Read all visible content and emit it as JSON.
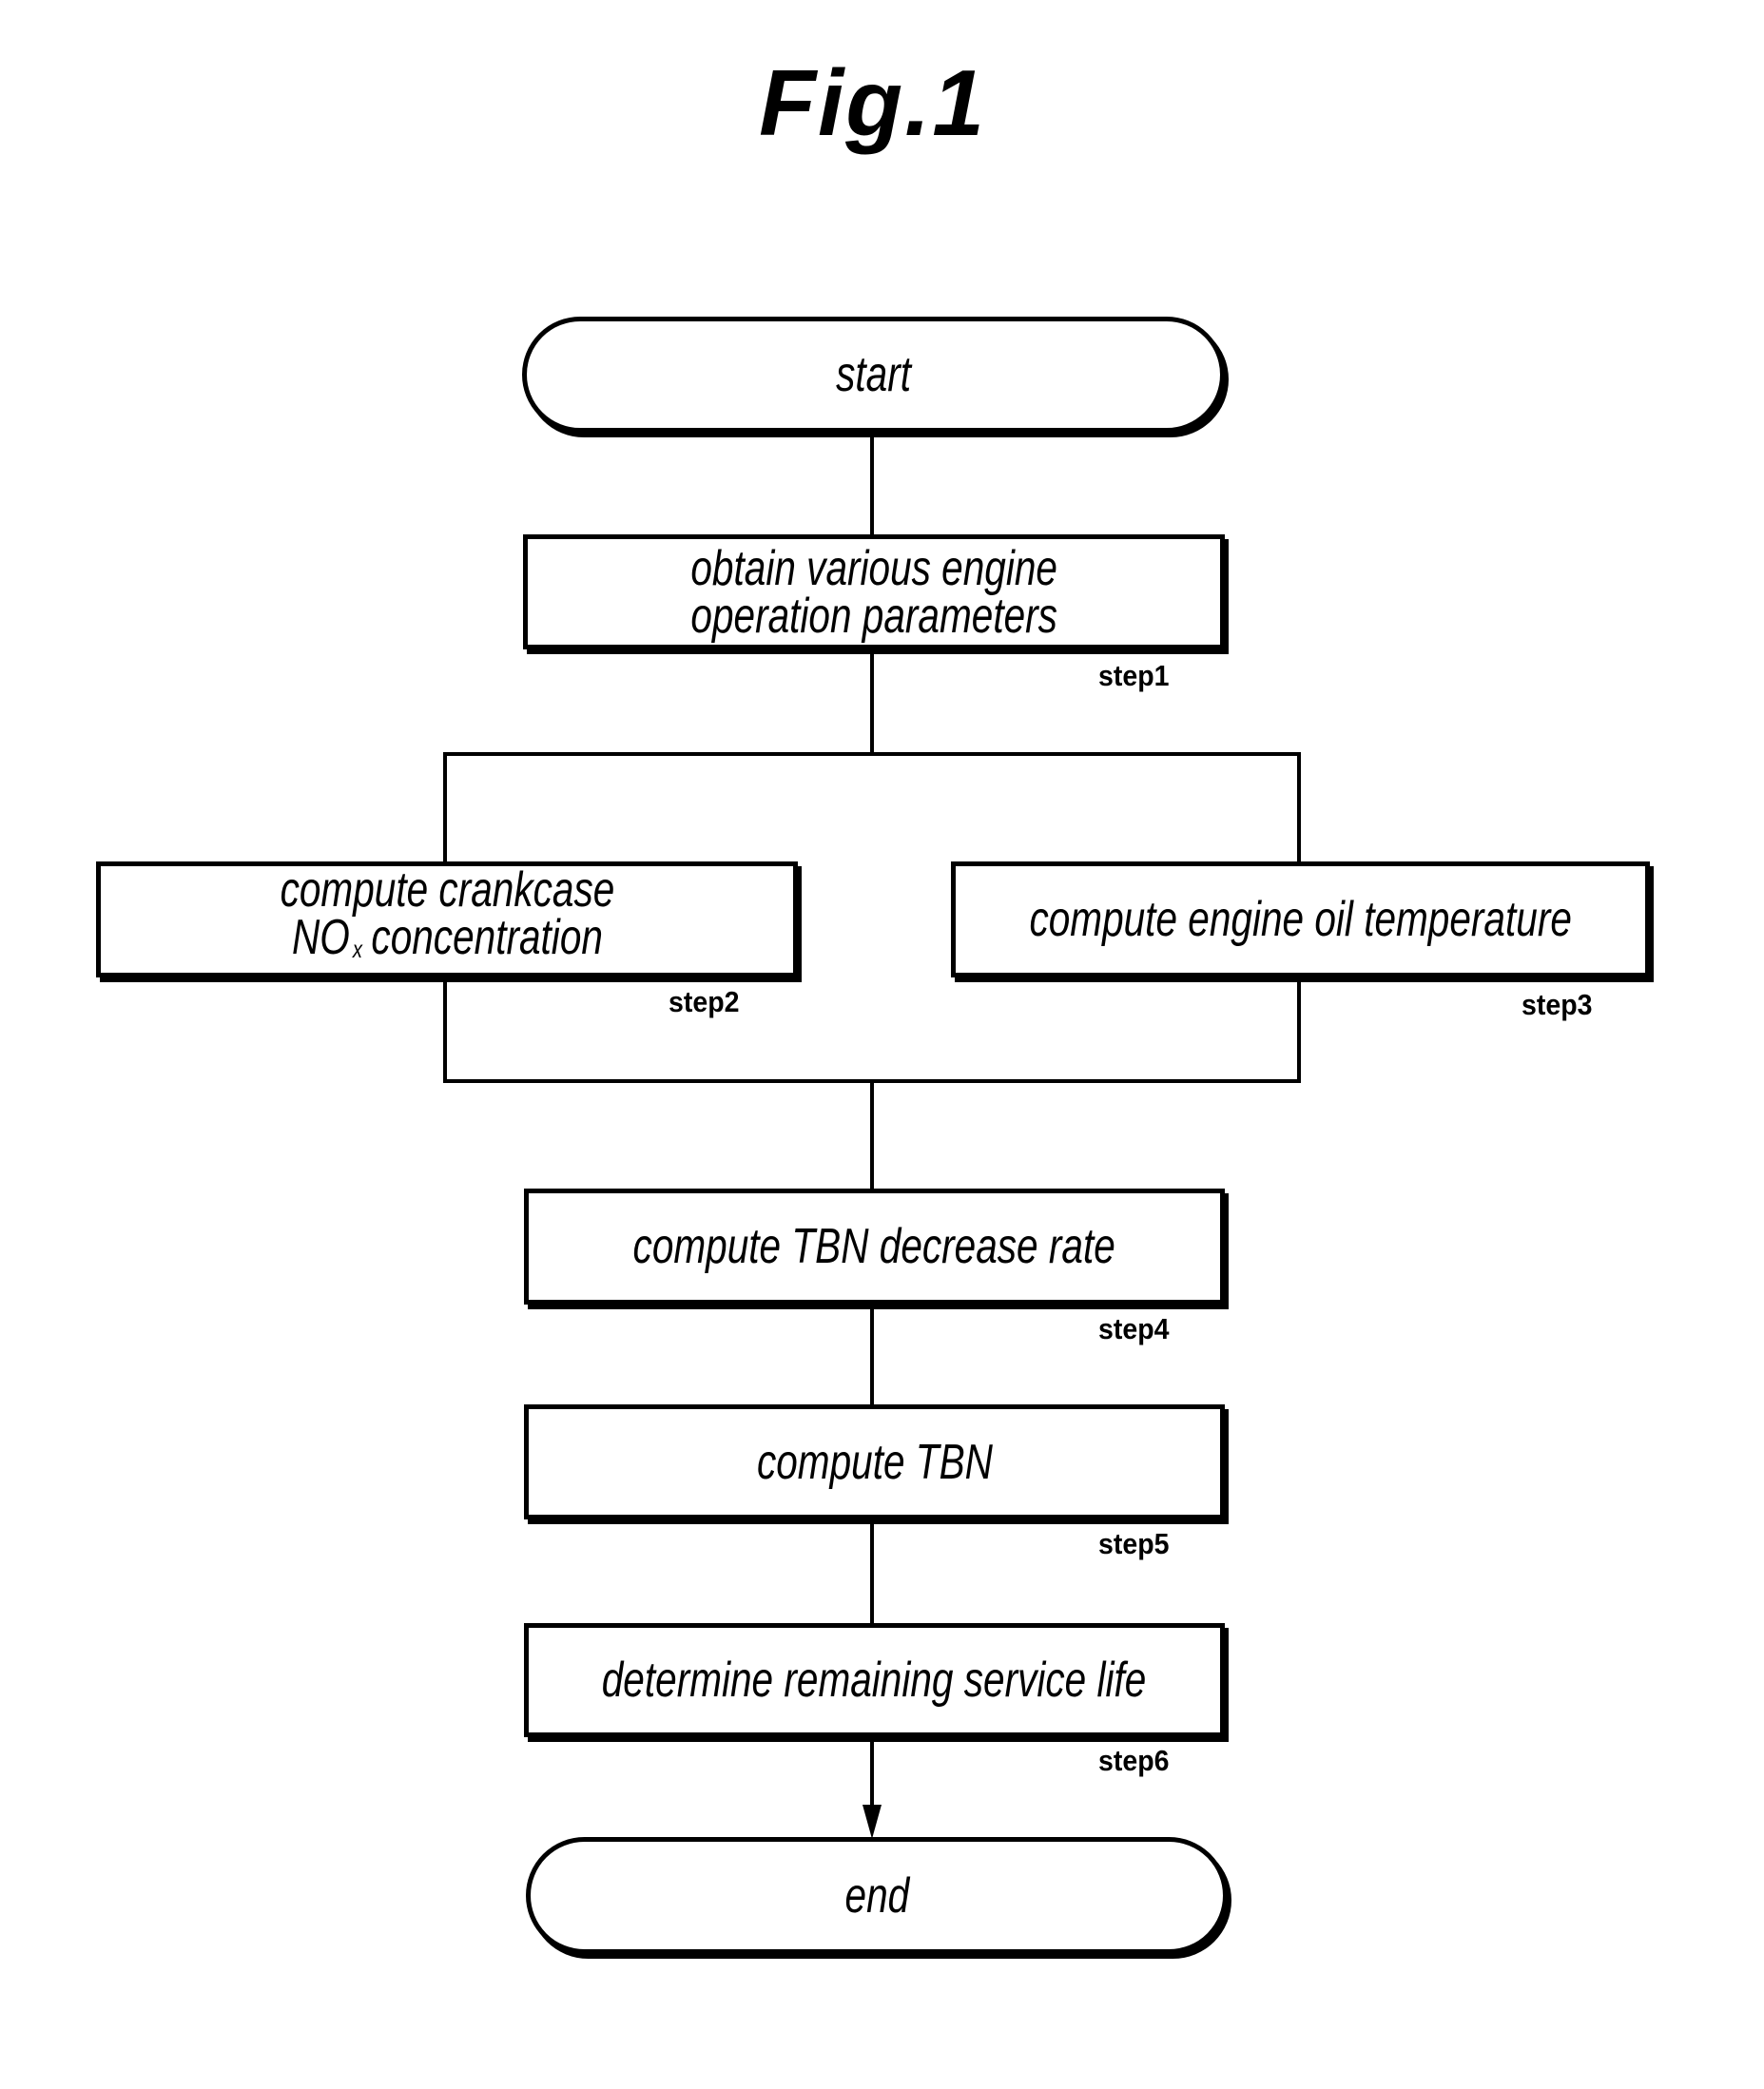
{
  "figure": {
    "title": "Fig.1",
    "type": "flowchart",
    "nodes": {
      "start": {
        "shape": "terminal",
        "text": "start"
      },
      "step1": {
        "shape": "process",
        "lines": [
          "obtain various engine",
          "operation parameters"
        ],
        "step_label": "step1"
      },
      "step2": {
        "shape": "process",
        "line1": "compute crankcase",
        "line2_main": "NO",
        "line2_sub": "x",
        "line2_rest": "concentration",
        "step_label": "step2"
      },
      "step3": {
        "shape": "process",
        "text": "compute engine oil temperature",
        "step_label": "step3"
      },
      "step4": {
        "shape": "process",
        "text": "compute TBN decrease rate",
        "step_label": "step4"
      },
      "step5": {
        "shape": "process",
        "text": "compute TBN",
        "step_label": "step5"
      },
      "step6": {
        "shape": "process",
        "text": "determine remaining service life",
        "step_label": "step6"
      },
      "end": {
        "shape": "terminal",
        "text": "end"
      }
    },
    "edges": [
      {
        "from": "start",
        "to": "step1"
      },
      {
        "from": "step1",
        "to": "step2",
        "type": "parallel-split"
      },
      {
        "from": "step1",
        "to": "step3",
        "type": "parallel-split"
      },
      {
        "from": "step2",
        "to": "step4",
        "type": "parallel-join"
      },
      {
        "from": "step3",
        "to": "step4",
        "type": "parallel-join"
      },
      {
        "from": "step4",
        "to": "step5"
      },
      {
        "from": "step5",
        "to": "step6"
      },
      {
        "from": "step6",
        "to": "end",
        "arrow": true
      }
    ],
    "colors": {
      "line": "#000000",
      "background": "#ffffff"
    }
  }
}
